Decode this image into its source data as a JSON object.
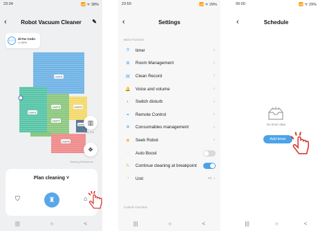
{
  "screen1": {
    "status": {
      "time": "23:34",
      "icons": "📶 ᯤ 38%"
    },
    "title": "Robot Vacuum Cleaner",
    "device": {
      "name": "di Far Cotin",
      "battery": "69%",
      "badge": "ECO"
    },
    "rooms": [
      "room1",
      "room2",
      "room3",
      "room4",
      "room5",
      "room6",
      "room7"
    ],
    "side_labels": {
      "map": "Map Edit",
      "pref": "Cleaning Preferences"
    },
    "plan_label": "Plan cleaning",
    "colors": {
      "accent": "#5aa7e8",
      "teal": "#57c4a7",
      "yellow": "#f3d96b",
      "red": "#ef8a8a",
      "green": "#8cc87f",
      "blue": "#6fb3e6"
    }
  },
  "screen2": {
    "status": {
      "time": "23:59",
      "icons": "📶 ᯤ 29%"
    },
    "title": "Settings",
    "section_basic": "Basic Function",
    "section_custom": "Custom Function",
    "items": [
      {
        "label": "timer",
        "icon": "⏱",
        "color": "#4aa3e8"
      },
      {
        "label": "Room Management",
        "icon": "⊞",
        "color": "#4aa3e8"
      },
      {
        "label": "Clean Record",
        "icon": "▤",
        "color": "#4aa3e8"
      },
      {
        "label": "Voice and volume",
        "icon": "🔔",
        "color": "#4aa3e8"
      },
      {
        "label": "Switch disturb",
        "icon": "◐",
        "color": "#f29a3b"
      },
      {
        "label": "Remote Control",
        "icon": "⚭",
        "color": "#4aa3e8"
      },
      {
        "label": "Consumables management",
        "icon": "✲",
        "color": "#4aa3e8"
      },
      {
        "label": "Seek Robot",
        "icon": "◉",
        "color": "#f2b33b"
      },
      {
        "label": "Auto Boost",
        "icon": "◌",
        "color": "#f2b33b"
      },
      {
        "label": "Continue cleaning at breakpoint",
        "icon": "↻",
        "color": "#f2b33b"
      },
      {
        "label": "Unit",
        "icon": "◔",
        "color": "#f29a3b",
        "value": "ml"
      }
    ],
    "auto_boost_on": false,
    "continue_on": true,
    "toggle_color": "#4aa3e8"
  },
  "screen3": {
    "status": {
      "time": "00:00",
      "icons": "📶 ᯤ 29%"
    },
    "title": "Schedule",
    "empty_text": "No timer data",
    "add_label": "Add timer"
  },
  "nav": {
    "recents": "|||",
    "home": "○",
    "back": "<"
  }
}
